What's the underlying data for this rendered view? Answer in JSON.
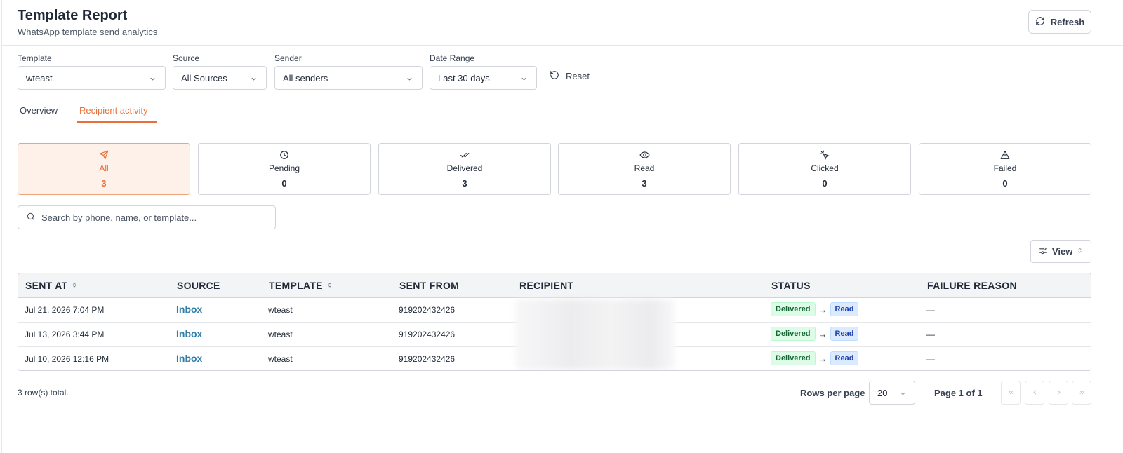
{
  "header": {
    "title": "Template Report",
    "subtitle": "WhatsApp template send analytics",
    "refresh_label": "Refresh"
  },
  "filters": {
    "template": {
      "label": "Template",
      "value": "wteast"
    },
    "source": {
      "label": "Source",
      "value": "All Sources"
    },
    "sender": {
      "label": "Sender",
      "value": "All senders"
    },
    "date_range": {
      "label": "Date Range",
      "value": "Last 30 days"
    },
    "reset_label": "Reset"
  },
  "tabs": [
    {
      "label": "Overview",
      "active": false
    },
    {
      "label": "Recipient activity",
      "active": true
    }
  ],
  "stats": [
    {
      "label": "All",
      "count": "3",
      "icon": "send-icon",
      "active": true
    },
    {
      "label": "Pending",
      "count": "0",
      "icon": "clock-icon",
      "active": false
    },
    {
      "label": "Delivered",
      "count": "3",
      "icon": "double-check-icon",
      "active": false
    },
    {
      "label": "Read",
      "count": "3",
      "icon": "eye-icon",
      "active": false
    },
    {
      "label": "Clicked",
      "count": "0",
      "icon": "pointer-click-icon",
      "active": false
    },
    {
      "label": "Failed",
      "count": "0",
      "icon": "warning-icon",
      "active": false
    }
  ],
  "search": {
    "placeholder": "Search by phone, name, or template..."
  },
  "view_label": "View",
  "table": {
    "columns": [
      "SENT AT",
      "SOURCE",
      "TEMPLATE",
      "SENT FROM",
      "RECIPIENT",
      "STATUS",
      "FAILURE REASON"
    ],
    "rows": [
      {
        "sent_at": "Jul 21, 2026 7:04 PM",
        "source": "Inbox",
        "template": "wteast",
        "sent_from": "919202432426",
        "status_from": "Delivered",
        "status_arrow": "→",
        "status_to": "Read",
        "failure_reason": "—"
      },
      {
        "sent_at": "Jul 13, 2026 3:44 PM",
        "source": "Inbox",
        "template": "wteast",
        "sent_from": "919202432426",
        "status_from": "Delivered",
        "status_arrow": "→",
        "status_to": "Read",
        "failure_reason": "—"
      },
      {
        "sent_at": "Jul 10, 2026 12:16 PM",
        "source": "Inbox",
        "template": "wteast",
        "sent_from": "919202432426",
        "status_from": "Delivered",
        "status_arrow": "→",
        "status_to": "Read",
        "failure_reason": "—"
      }
    ]
  },
  "footer": {
    "total": "3 row(s) total.",
    "rows_per_page_label": "Rows per page",
    "rows_per_page_value": "20",
    "page_label": "Page 1 of 1"
  },
  "colors": {
    "accent": "#e8703a",
    "link": "#2f7ea8",
    "delivered_bg": "#dcfce7",
    "read_bg": "#dbeafe"
  }
}
